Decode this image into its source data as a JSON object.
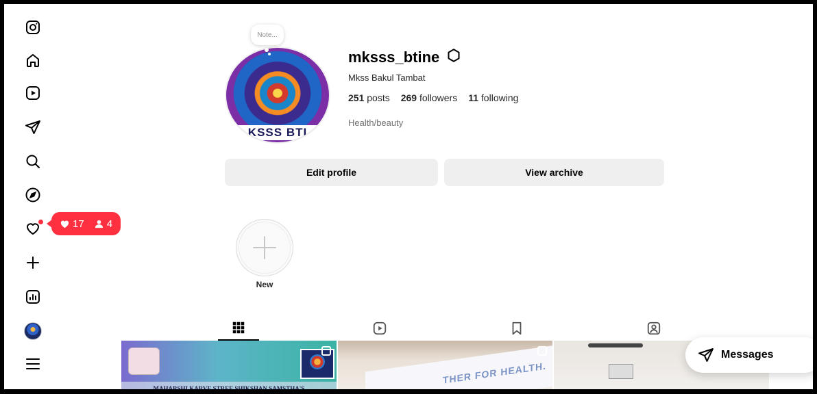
{
  "profile": {
    "note": "Note...",
    "username": "mksss_btine",
    "full_name": "Mkss Bakul Tambat",
    "pic_text": "KSSS BTI",
    "posts_count": "251",
    "posts_label": "posts",
    "followers_count": "269",
    "followers_label": "followers",
    "following_count": "11",
    "following_label": "following",
    "category": "Health/beauty"
  },
  "buttons": {
    "edit_profile": "Edit profile",
    "view_archive": "View archive"
  },
  "highlights": {
    "new_label": "New"
  },
  "notifications": {
    "likes": "17",
    "follows": "4"
  },
  "grid": {
    "tile1_banner": "MAHARSHI KARVE STREE SHIKSHAN SAMSTHA'S",
    "tile2_text": "THER FOR HEALTH."
  },
  "messages": {
    "label": "Messages"
  },
  "colors": {
    "notification_red": "#ff3040",
    "button_gray": "#efefef"
  }
}
